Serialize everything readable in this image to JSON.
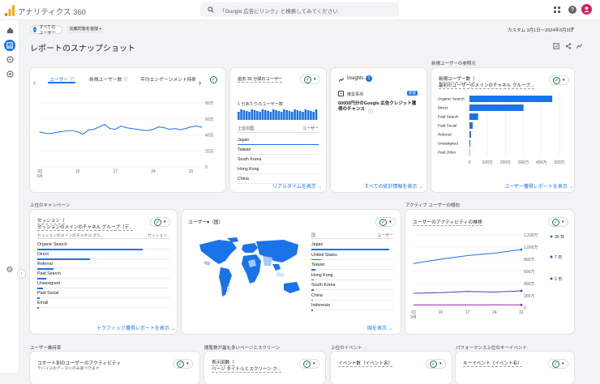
{
  "app": {
    "name": "アナリティクス 360",
    "search_placeholder": "「Google 広告にリンク」と検索してみてください",
    "avatar_color": "#d81b60",
    "logo_colors": [
      "#f9ab00",
      "#e37400"
    ]
  },
  "filterbar": {
    "chip_all_users": "すべてのユーザー",
    "chip_badge": "A",
    "add_comparison": "比較対象を追加 +",
    "date_range": "カスタム 3月1日～2024年3月3日"
  },
  "page": {
    "title": "レポートのスナップショット"
  },
  "card_users": {
    "tabs": [
      "ユーザー",
      "新規ユーザー数",
      "平均エンゲージメント時間"
    ],
    "y_ticks": [
      "80万",
      "60万",
      "40万",
      "20万",
      "0"
    ],
    "x_ticks": [
      "03",
      "10",
      "17",
      "24",
      "31"
    ],
    "x_month": "3月",
    "chart_data": {
      "type": "line",
      "x": [
        "03/01",
        "03/02",
        "03/03",
        "03/04",
        "03/05",
        "03/06",
        "03/07",
        "03/08",
        "03/09",
        "03/10",
        "03/11",
        "03/12",
        "03/13",
        "03/14",
        "03/15",
        "03/16",
        "03/17",
        "03/18",
        "03/19",
        "03/20",
        "03/21",
        "03/22",
        "03/23",
        "03/24",
        "03/25",
        "03/26",
        "03/27",
        "03/28",
        "03/29",
        "03/30",
        "03/31"
      ],
      "values": [
        435000,
        420000,
        418000,
        430000,
        440000,
        450000,
        455000,
        438000,
        410000,
        460000,
        470000,
        500000,
        530000,
        480000,
        470000,
        510000,
        490000,
        480000,
        470000,
        460000,
        455000,
        470000,
        500000,
        490000,
        470000,
        480000,
        465000,
        480000,
        500000,
        510000,
        495000
      ],
      "ylim": [
        0,
        800000
      ]
    }
  },
  "card_realtime": {
    "title": "過去 30 分間のユーザー",
    "big_value": "",
    "per_minute": "1 分あたりのユーザー数",
    "col_country": "上位の国",
    "col_users": "ユーザー",
    "countries": [
      "Japan",
      "Taiwan",
      "South Korea",
      "Hong Kong",
      "China"
    ],
    "link": "リアルタイムを表示 →"
  },
  "card_insights": {
    "title": "Insights",
    "badge": "1",
    "tag": "推奨事項",
    "new_badge": "新着",
    "text": "60000円分のGoogle 広告クレジット獲得のチャンス",
    "link": "すべての統計情報を表示 →"
  },
  "card_newusers": {
    "section": "新規ユーザーの参照元",
    "title": "新規ユーザー数（",
    "subtitle": "最初のユーザーのメインのチャネル グループ...",
    "x_ticks": [
      "0",
      "100万",
      "200万",
      "300万",
      "400万",
      "500万"
    ],
    "link": "ユーザー獲得レポートを表示 →",
    "chart_data": {
      "type": "bar",
      "categories": [
        "Organic Search",
        "Direct",
        "Paid Search",
        "Paid Social",
        "Referral",
        "Unassigned",
        "Paid Other"
      ],
      "values": [
        4600000,
        3000000,
        480000,
        180000,
        90000,
        50000,
        20000
      ],
      "xlim": [
        0,
        5000000
      ]
    }
  },
  "card_campaign": {
    "section": "上位のキャンペーン",
    "title": "セッション（",
    "subtitle": "セッションのメインのチャネル グループ（デ...",
    "col_left": "セッションのメインのチャネル グル...",
    "col_right": "セッション",
    "rows": [
      "Organic Search",
      "Direct",
      "Referral",
      "Paid Search",
      "Unassigned",
      "Paid Social",
      "Email"
    ],
    "bar_fractions": [
      0.8,
      0.4,
      0.12,
      0.07,
      0.04,
      0.02,
      0.01
    ],
    "link": "トラフィック獲得レポートを表示 →"
  },
  "card_country": {
    "title": "ユーザー▾（国）",
    "col_country": "国",
    "col_users": "ユーザー",
    "countries": [
      "Japan",
      "United States",
      "Taiwan",
      "Hong Kong",
      "South Korea",
      "China",
      "Indonesia"
    ],
    "bar_fractions": [
      0.95,
      0.12,
      0.05,
      0.03,
      0.03,
      0.02,
      0.02
    ],
    "link": "国を表示 →"
  },
  "card_active": {
    "section": "アクティブ ユーザーの傾向",
    "title": "ユーザーのアクティビティの推移",
    "y_ticks": [
      "1,200万",
      "1,000万",
      "800万",
      "600万",
      "400万",
      "200万",
      "0"
    ],
    "x_ticks": [
      "03",
      "10",
      "17",
      "24",
      "31"
    ],
    "x_month": "3月",
    "legend": [
      {
        "label": "30 日",
        "color": "#1a73e8"
      },
      {
        "label": "7 日",
        "color": "#5e35b1"
      },
      {
        "label": "1 日",
        "color": "#9c27b0"
      }
    ],
    "chart_data": {
      "type": "line",
      "x": [
        "03",
        "10",
        "17",
        "24",
        "31"
      ],
      "series": [
        {
          "name": "30 日",
          "values": [
            7300000,
            8000000,
            8600000,
            9000000,
            9600000
          ]
        },
        {
          "name": "7 日",
          "values": [
            2400000,
            2500000,
            2700000,
            2600000,
            2800000
          ]
        },
        {
          "name": "1 日",
          "values": [
            480000,
            490000,
            480000,
            500000,
            490000
          ]
        }
      ],
      "ylim": [
        0,
        12000000
      ]
    }
  },
  "bottom": {
    "sections": [
      "ユーザー維持率",
      "閲覧数が最も多いページとスクリーン",
      "上位のイベント",
      "パフォーマンス上位のキーイベント"
    ],
    "retention_title": "コホート別のユーザーのアクティビティ",
    "retention_sub": "デバイスのデータにのみ基づきます",
    "pages_title": "表示回数（",
    "pages_sub": "ページ タイトルとスクリーン ク...",
    "events_title": "イベント数（イベント名）",
    "keyevents_title": "キーイベント（イベント名）"
  }
}
